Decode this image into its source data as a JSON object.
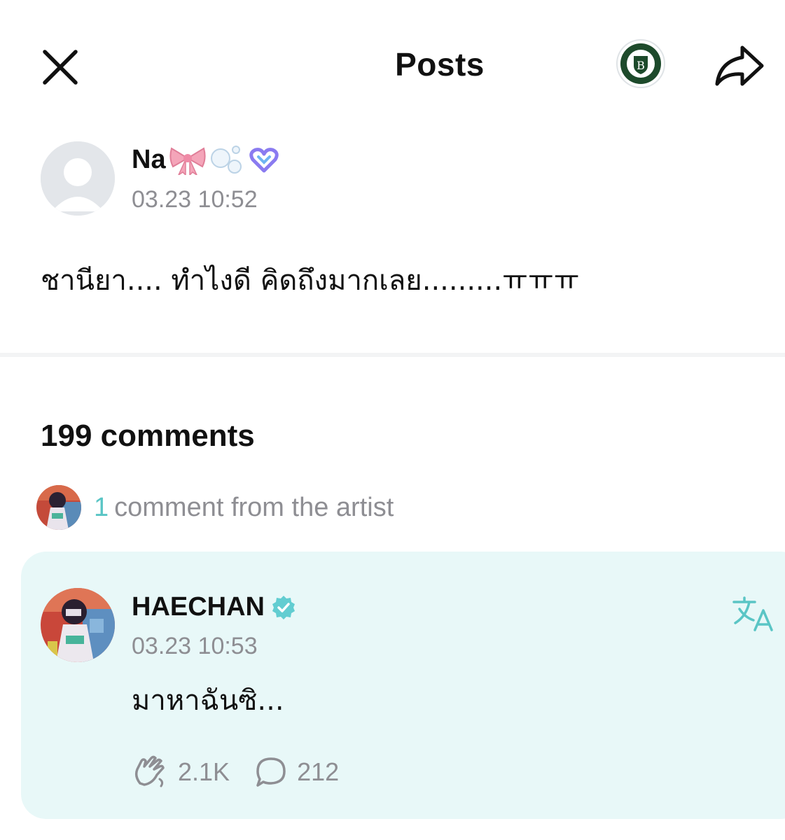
{
  "header": {
    "title": "Posts",
    "close_icon": "close-icon",
    "share_icon": "share-icon",
    "community_icon": "community-badge-icon"
  },
  "post": {
    "author": {
      "name": "Na",
      "decorations": [
        "ribbon-emoji",
        "bubbles-emoji",
        "purple-heart-badge-icon"
      ]
    },
    "timestamp": "03.23 10:52",
    "body": "ชานียา.... ทำไงดี คิดถึงมากเลย.........ㅠㅠㅠ"
  },
  "comments": {
    "count_label": "199 comments",
    "artist_summary": {
      "count": "1",
      "label": "comment from the artist"
    },
    "artist_comment": {
      "author": "HAECHAN",
      "verified": true,
      "timestamp": "03.23 10:53",
      "body": "มาหาฉันซิ...",
      "likes": "2.1K",
      "replies": "212"
    }
  },
  "colors": {
    "accent": "#5ac5c5",
    "card_bg": "#e8f8f8",
    "muted_text": "#8e8e93",
    "verified": "#62cdd1"
  }
}
